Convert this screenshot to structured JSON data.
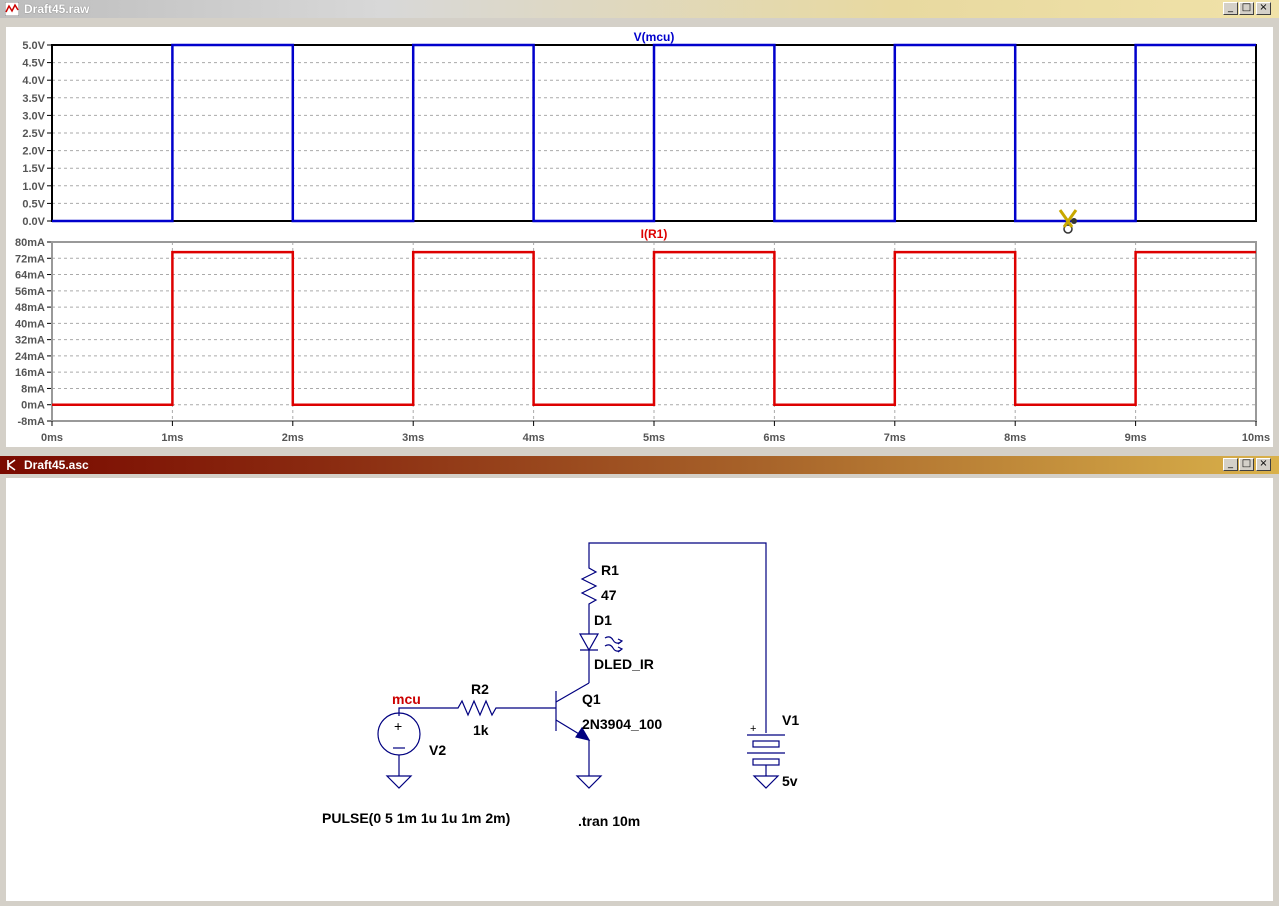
{
  "waveform_window": {
    "title": "Draft45.raw",
    "buttons": {
      "minimize": "_",
      "maximize": "□",
      "close": "×"
    },
    "top_plot": {
      "trace_label": "V(mcu)",
      "color": "#0000cc",
      "y_ticks": [
        "5.0V",
        "4.5V",
        "4.0V",
        "3.5V",
        "3.0V",
        "2.5V",
        "2.0V",
        "1.5V",
        "1.0V",
        "0.5V",
        "0.0V"
      ],
      "ylim": [
        0,
        5
      ],
      "x": [
        0,
        1,
        1,
        2,
        2,
        3,
        3,
        4,
        4,
        5,
        5,
        6,
        6,
        7,
        7,
        8,
        8,
        9,
        9,
        10
      ],
      "y": [
        0,
        0,
        5,
        5,
        0,
        0,
        5,
        5,
        0,
        0,
        5,
        5,
        0,
        0,
        5,
        5,
        0,
        0,
        5,
        5
      ]
    },
    "bottom_plot": {
      "trace_label": "I(R1)",
      "color": "#dd0000",
      "y_ticks": [
        "80mA",
        "72mA",
        "64mA",
        "56mA",
        "48mA",
        "40mA",
        "32mA",
        "24mA",
        "16mA",
        "8mA",
        "0mA",
        "-8mA"
      ],
      "ylim": [
        -8,
        80
      ],
      "x": [
        0,
        1,
        1,
        2,
        2,
        3,
        3,
        4,
        4,
        5,
        5,
        6,
        6,
        7,
        7,
        8,
        8,
        9,
        9,
        10
      ],
      "y": [
        0,
        0,
        75,
        75,
        0,
        0,
        75,
        75,
        0,
        0,
        75,
        75,
        0,
        0,
        75,
        75,
        0,
        0,
        75,
        75
      ]
    },
    "x_ticks": [
      "0ms",
      "1ms",
      "2ms",
      "3ms",
      "4ms",
      "5ms",
      "6ms",
      "7ms",
      "8ms",
      "9ms",
      "10ms"
    ],
    "xlim": [
      0,
      10
    ]
  },
  "schematic_window": {
    "title": "Draft45.asc",
    "buttons": {
      "minimize": "_",
      "maximize": "□",
      "close": "×"
    },
    "labels": {
      "r1_name": "R1",
      "r1_value": "47",
      "d1_name": "D1",
      "d1_model": "DLED_IR",
      "q1_name": "Q1",
      "q1_model": "2N3904_100",
      "r2_name": "R2",
      "r2_value": "1k",
      "net_mcu": "mcu",
      "v2_name": "V2",
      "v2_value": "PULSE(0 5 1m 1u 1u 1m 2m)",
      "v1_name": "V1",
      "v1_value": "5v",
      "directive": ".tran 10m",
      "v2_plus": "+",
      "v1_plus": "+"
    },
    "net_label_color": "#cc0000"
  }
}
